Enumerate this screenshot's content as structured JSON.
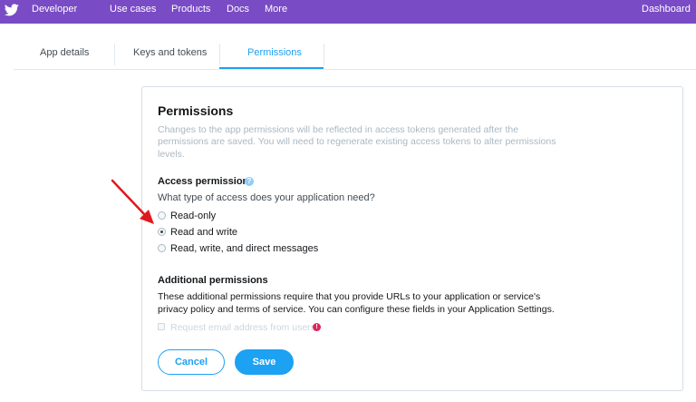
{
  "nav": {
    "brand": "Developer",
    "items": [
      "Use cases",
      "Products",
      "Docs",
      "More"
    ],
    "right": "Dashboard"
  },
  "tabs": [
    {
      "label": "App details"
    },
    {
      "label": "Keys and tokens"
    },
    {
      "label": "Permissions"
    }
  ],
  "permissions": {
    "title": "Permissions",
    "description": "Changes to the app permissions will be reflected in access tokens generated after the permissions are saved. You will need to regenerate existing access tokens to alter permissions levels."
  },
  "access": {
    "heading": "Access permission",
    "help_icon": "?",
    "question": "What type of access does your application need?",
    "options": [
      {
        "label": "Read-only",
        "selected": false
      },
      {
        "label": "Read and write",
        "selected": true
      },
      {
        "label": "Read, write, and direct messages",
        "selected": false
      }
    ]
  },
  "additional": {
    "heading": "Additional permissions",
    "text": "These additional permissions require that you provide URLs to your application or service's privacy policy and terms of service. You can configure these fields in your Application Settings.",
    "checkbox_label": "Request email address from users",
    "warn_icon": "!"
  },
  "buttons": {
    "cancel": "Cancel",
    "save": "Save"
  },
  "colors": {
    "nav_bg": "#794bc4",
    "accent": "#1da1f2",
    "arrow": "#e0191d",
    "warn": "#e0245e"
  }
}
